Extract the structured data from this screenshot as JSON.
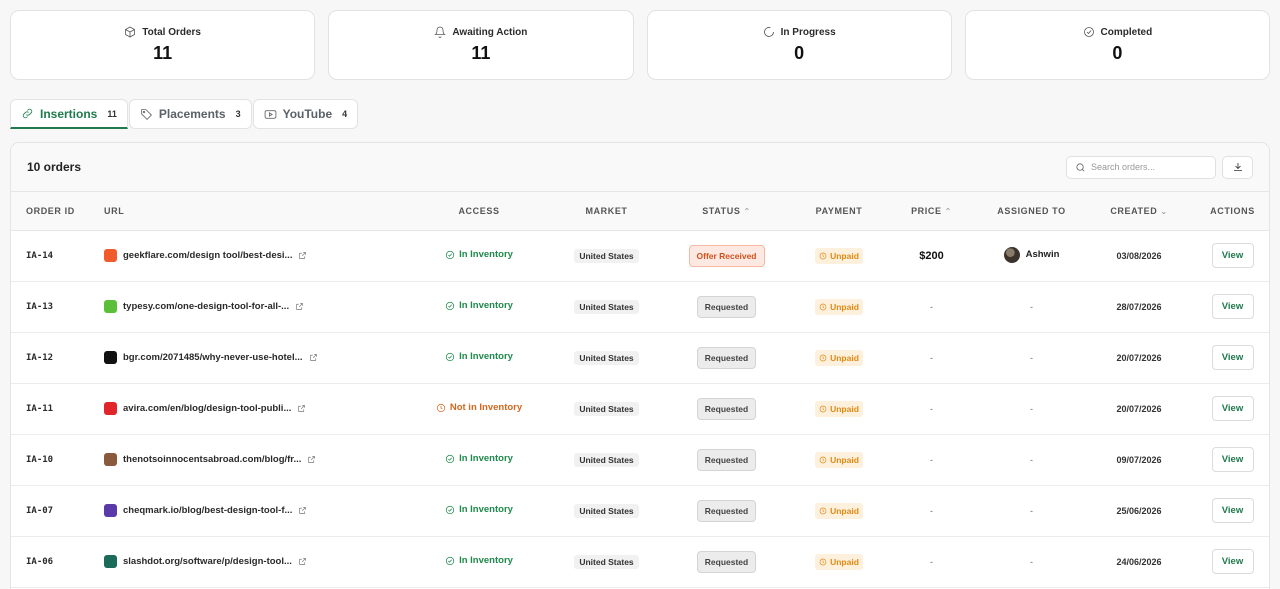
{
  "stats": [
    {
      "label": "Total Orders",
      "value": "11",
      "icon": "box-icon"
    },
    {
      "label": "Awaiting Action",
      "value": "11",
      "icon": "bell-icon"
    },
    {
      "label": "In Progress",
      "value": "0",
      "icon": "spinner-icon"
    },
    {
      "label": "Completed",
      "value": "0",
      "icon": "check-circle-icon"
    }
  ],
  "tabs": [
    {
      "label": "Insertions",
      "count": "11",
      "icon": "link-icon",
      "active": true
    },
    {
      "label": "Placements",
      "count": "3",
      "icon": "tag-icon",
      "active": false
    },
    {
      "label": "YouTube",
      "count": "4",
      "icon": "youtube-icon",
      "active": false
    }
  ],
  "panel": {
    "orders_count": "10 orders",
    "search_placeholder": "Search orders...",
    "download_icon": "download-icon"
  },
  "columns": {
    "order_id": "ORDER ID",
    "url": "URL",
    "access": "ACCESS",
    "market": "MARKET",
    "status": "STATUS",
    "payment": "PAYMENT",
    "price": "PRICE",
    "assigned_to": "ASSIGNED TO",
    "created": "CREATED",
    "actions": "ACTIONS"
  },
  "colors": {
    "accent_green": "#1f7a4d",
    "inventory_green": "#1f8a4c",
    "not_inventory_orange": "#d2691e",
    "offer_orange": "#d2511c",
    "unpaid_orange": "#e18a14"
  },
  "rows": [
    {
      "id": "IA-14",
      "url": "geekflare.com/design tool/best-desi...",
      "fav": "#f15a2b",
      "access": "In Inventory",
      "access_ok": true,
      "market": "United States",
      "status": "Offer Received",
      "status_type": "offer",
      "payment": "Unpaid",
      "price": "$200",
      "assigned": "Ashwin",
      "created": "03/08/2026",
      "action": "View"
    },
    {
      "id": "IA-13",
      "url": "typesy.com/one-design-tool-for-all-...",
      "fav": "#5bbf3a",
      "access": "In Inventory",
      "access_ok": true,
      "market": "United States",
      "status": "Requested",
      "status_type": "requested",
      "payment": "Unpaid",
      "price": "-",
      "assigned": "-",
      "created": "28/07/2026",
      "action": "View"
    },
    {
      "id": "IA-12",
      "url": "bgr.com/2071485/why-never-use-hotel...",
      "fav": "#111111",
      "access": "In Inventory",
      "access_ok": true,
      "market": "United States",
      "status": "Requested",
      "status_type": "requested",
      "payment": "Unpaid",
      "price": "-",
      "assigned": "-",
      "created": "20/07/2026",
      "action": "View"
    },
    {
      "id": "IA-11",
      "url": "avira.com/en/blog/design-tool-publi...",
      "fav": "#e0262a",
      "access": "Not in Inventory",
      "access_ok": false,
      "market": "United States",
      "status": "Requested",
      "status_type": "requested",
      "payment": "Unpaid",
      "price": "-",
      "assigned": "-",
      "created": "20/07/2026",
      "action": "View"
    },
    {
      "id": "IA-10",
      "url": "thenotsoinnocentsabroad.com/blog/fr...",
      "fav": "#8a5a3c",
      "access": "In Inventory",
      "access_ok": true,
      "market": "United States",
      "status": "Requested",
      "status_type": "requested",
      "payment": "Unpaid",
      "price": "-",
      "assigned": "-",
      "created": "09/07/2026",
      "action": "View"
    },
    {
      "id": "IA-07",
      "url": "cheqmark.io/blog/best-design-tool-f...",
      "fav": "#5a3aa8",
      "access": "In Inventory",
      "access_ok": true,
      "market": "United States",
      "status": "Requested",
      "status_type": "requested",
      "payment": "Unpaid",
      "price": "-",
      "assigned": "-",
      "created": "25/06/2026",
      "action": "View"
    },
    {
      "id": "IA-06",
      "url": "slashdot.org/software/p/design-tool...",
      "fav": "#1a6b5a",
      "access": "In Inventory",
      "access_ok": true,
      "market": "United States",
      "status": "Requested",
      "status_type": "requested",
      "payment": "Unpaid",
      "price": "-",
      "assigned": "-",
      "created": "24/06/2026",
      "action": "View"
    }
  ]
}
